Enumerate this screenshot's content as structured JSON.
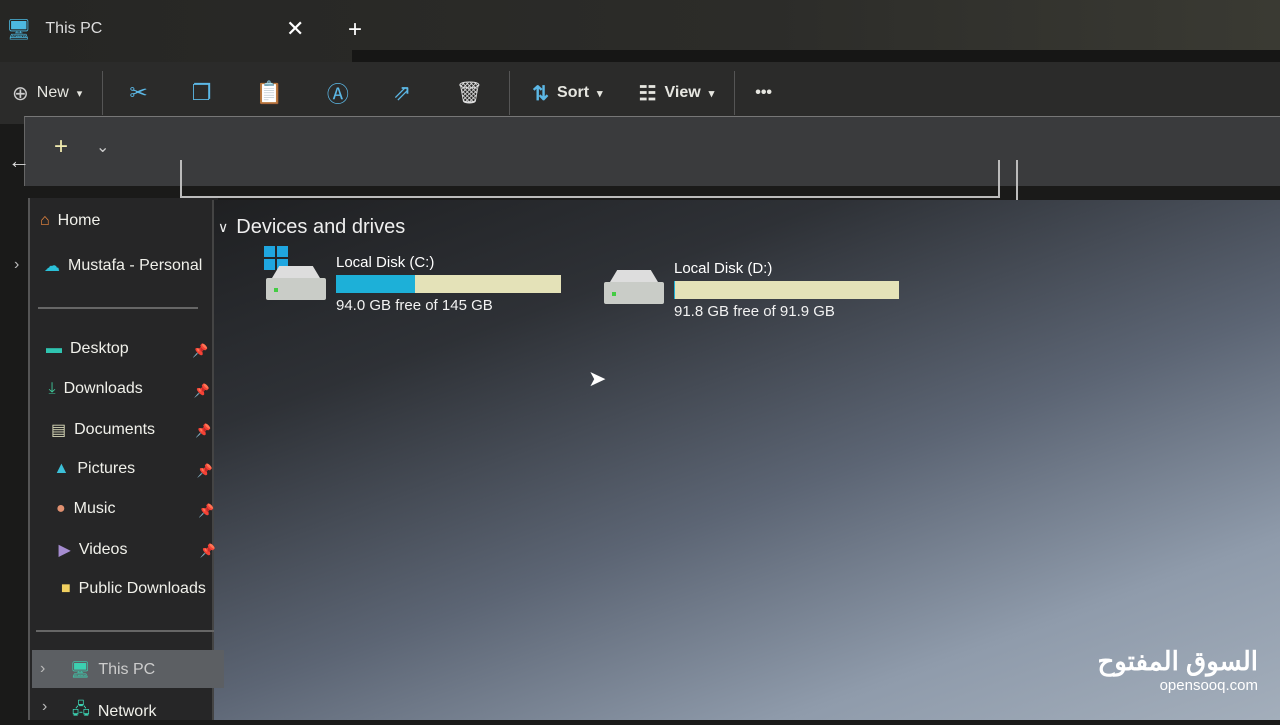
{
  "window": {
    "tab_title": "This PC",
    "close_icon": "close-icon",
    "new_tab_icon": "plus-icon"
  },
  "toolbar": {
    "new_label": "New",
    "sort_label": "Sort",
    "view_label": "View",
    "more_label": "•••",
    "icons": [
      "cut-icon",
      "copy-icon",
      "paste-icon",
      "rename-icon",
      "share-icon",
      "delete-icon"
    ]
  },
  "sidebar": {
    "home": "Home",
    "onedrive": "Mustafa - Personal",
    "quick_access": [
      {
        "label": "Desktop",
        "icon": "desktop-folder-icon",
        "color": "#2fc4b0"
      },
      {
        "label": "Downloads",
        "icon": "download-icon",
        "color": "#3ec89a"
      },
      {
        "label": "Documents",
        "icon": "documents-icon",
        "color": "#d8d8b8"
      },
      {
        "label": "Pictures",
        "icon": "pictures-icon",
        "color": "#3cc0d8"
      },
      {
        "label": "Music",
        "icon": "music-icon",
        "color": "#e09070"
      },
      {
        "label": "Videos",
        "icon": "videos-icon",
        "color": "#a58cd0"
      },
      {
        "label": "Public Downloads",
        "icon": "folder-icon",
        "color": "#f0d060"
      }
    ],
    "this_pc": "This PC",
    "network": "Network"
  },
  "main": {
    "section_title": "Devices and drives",
    "drives": [
      {
        "name": "Local Disk (C:)",
        "free_text": "94.0 GB free of 145 GB",
        "used_fraction": 0.35,
        "system": true
      },
      {
        "name": "Local Disk (D:)",
        "free_text": "91.8 GB free of 91.9 GB",
        "used_fraction": 0.001,
        "system": false
      }
    ]
  },
  "watermark": {
    "arabic": "السوق المفتوح",
    "latin": "opensooq.com"
  },
  "colors": {
    "accent": "#1db0d8",
    "drive_bar_bg": "#e4e2b8"
  }
}
